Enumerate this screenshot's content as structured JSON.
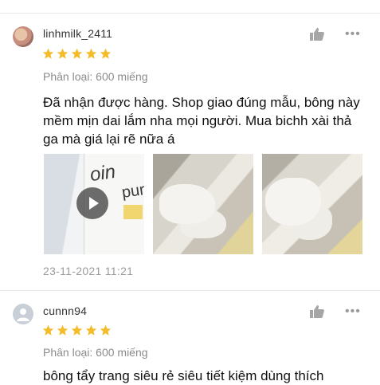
{
  "colors": {
    "star": "#f5bc2a",
    "text_muted": "#8b8b8b",
    "divider": "#e8e8e8"
  },
  "reviews": [
    {
      "username": "linhmilk_2411",
      "rating": 5,
      "variant": "Phân loại: 600 miếng",
      "content": "Đã nhận được hàng. Shop giao đúng mẫu, bông này mềm mịn dai lắm nha mọi người. Mua bichh xài thả ga mà giá lại rẽ nữa á",
      "media_prints": [
        "oin",
        "pur"
      ],
      "date": "23-11-2021 11:21"
    },
    {
      "username": "cunnn94",
      "rating": 5,
      "variant": "Phân loại: 600 miếng",
      "content": "bông tẩy trang siêu rẻ siêu tiết kiệm dùng thích"
    }
  ],
  "icons": {
    "like": "thumbs-up-icon",
    "more": "more-dots-icon",
    "play": "play-icon",
    "star": "star-icon"
  },
  "more_label": "•••"
}
